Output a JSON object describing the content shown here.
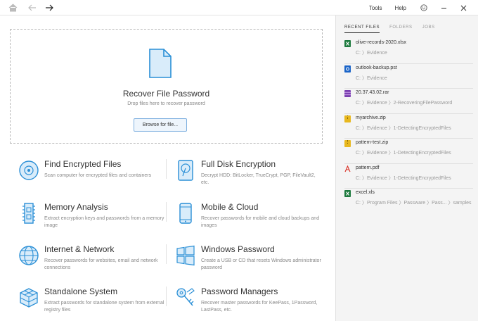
{
  "topbar": {
    "tools": "Tools",
    "help": "Help",
    "icons": [
      "home-icon",
      "back-arrow-icon",
      "forward-arrow-icon",
      "smiley-icon",
      "minimize-icon",
      "close-icon"
    ]
  },
  "dropzone": {
    "title": "Recover File Password",
    "subtitle": "Drop files here to recover password",
    "browse_label": "Browse for file..."
  },
  "features": [
    {
      "title": "Find Encrypted Files",
      "desc": "Scan computer for encrypted files and containers",
      "icon": "disc-icon"
    },
    {
      "title": "Full Disk Encryption",
      "desc": "Decrypt HDD: BitLocker, TrueCrypt, PGP, FileVault2, etc.",
      "icon": "hard-drive-icon"
    },
    {
      "title": "Memory Analysis",
      "desc": "Extract encryption keys and passwords from a memory image",
      "icon": "memory-module-icon"
    },
    {
      "title": "Mobile & Cloud",
      "desc": "Recover passwords for mobile and cloud backups and images",
      "icon": "mobile-phone-icon"
    },
    {
      "title": "Internet & Network",
      "desc": "Recover passwords for websites, email and network connections",
      "icon": "globe-icon"
    },
    {
      "title": "Windows Password",
      "desc": "Create a USB or CD that resets Windows administrator password",
      "icon": "windows-logo-icon"
    },
    {
      "title": "Standalone System",
      "desc": "Extract passwords for standalone system from external registry files",
      "icon": "cube-icon"
    },
    {
      "title": "Password Managers",
      "desc": "Recover master passwords for KeePass, 1Password, LastPass, etc.",
      "icon": "keys-icon"
    }
  ],
  "sidebar": {
    "tabs": [
      "RECENT FILES",
      "FOLDERS",
      "JOBS"
    ],
    "recent": [
      {
        "name": "olive-records-2020.xlsx",
        "path": "C: 〉Evidence",
        "type": "excel",
        "color": "#1d7a3e"
      },
      {
        "name": "outlook-backup.pst",
        "path": "C: 〉Evidence",
        "type": "outlook",
        "color": "#1a64c8"
      },
      {
        "name": "20.37.43.02.rar",
        "path": "C: 〉Evidence 〉2-RecoveringFilePassword",
        "type": "rar",
        "color": "#7b3fb0"
      },
      {
        "name": "myarchive.zip",
        "path": "C: 〉Evidence 〉1-DetectingEncryptedFiles",
        "type": "zip",
        "color": "#e8b81e"
      },
      {
        "name": "pattern-test.zip",
        "path": "C: 〉Evidence 〉1-DetectingEncryptedFiles",
        "type": "zip",
        "color": "#e8b81e"
      },
      {
        "name": "pattern.pdf",
        "path": "C: 〉Evidence 〉1-DetectingEncryptedFiles",
        "type": "pdf",
        "color": "#d93025"
      },
      {
        "name": "excel.xls",
        "path": "C: 〉Program Files 〉Passware 〉Pass... 〉samples",
        "type": "excel",
        "color": "#1d7a3e"
      }
    ]
  },
  "colors": {
    "accent": "#2a8fd6",
    "panel": "#f4f4f4"
  }
}
